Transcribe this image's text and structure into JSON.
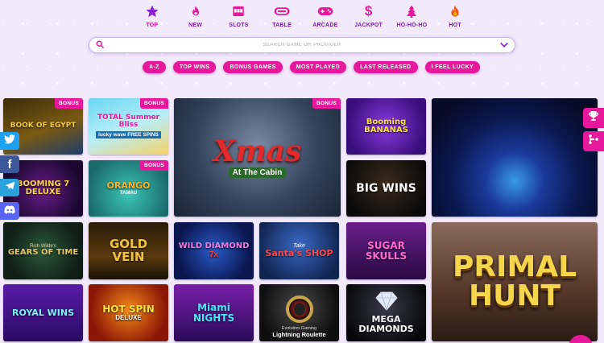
{
  "nav": {
    "items": [
      {
        "label": "TOP",
        "icon": "star-icon"
      },
      {
        "label": "NEW",
        "icon": "flame-icon"
      },
      {
        "label": "SLOTS",
        "icon": "slot-machine-icon"
      },
      {
        "label": "TABLE",
        "icon": "table-icon"
      },
      {
        "label": "ARCADE",
        "icon": "gamepad-icon"
      },
      {
        "label": "JACKPOT",
        "icon": "dollar-icon"
      },
      {
        "label": "HO-HO-HO",
        "icon": "christmas-tree-icon"
      },
      {
        "label": "HOT",
        "icon": "fire-icon"
      }
    ],
    "active": "TOP"
  },
  "search": {
    "placeholder": "SEARCH GAME OR PROVIDER"
  },
  "filters": [
    "A-Z",
    "TOP WINS",
    "BONUS GAMES",
    "MOST PLAYED",
    "LAST RELEASED",
    "I FEEL LUCKY"
  ],
  "badge_label": "BONUS",
  "games": {
    "book_of_egypt": {
      "title": "BOOK OF EGYPT"
    },
    "total_summer_bliss": {
      "title": "TOTAL Summer Bliss",
      "subtitle": "lucky wave FREE SPINS"
    },
    "xmas_cabin": {
      "title": "Xmas",
      "subtitle": "At The Cabin"
    },
    "booming_bananas": {
      "title": "Booming BANANAS"
    },
    "cosmic": {
      "title": ""
    },
    "booming_seven_deluxe": {
      "title": "BOOMING 7 DELUXE"
    },
    "orango": {
      "title": "ORANGO",
      "subtitle": "TAMAU"
    },
    "big_wins": {
      "title": "BIG WINS"
    },
    "gears_of_time": {
      "title": "GEARS OF TIME",
      "subtitle": "Rich Wilde's"
    },
    "gold_vein": {
      "title": "GOLD VEIN"
    },
    "wild_diamond": {
      "title": "WILD DIAMOND",
      "subtitle": "7x"
    },
    "santas_shop": {
      "title": "Santa's SHOP",
      "subtitle": "Take"
    },
    "sugar_skulls": {
      "title": "SUGAR SKULLS"
    },
    "primal_hunt": {
      "title": "PRIMAL HUNT"
    },
    "royal_wins": {
      "title": "ROYAL WINS"
    },
    "hot_spin_deluxe": {
      "title": "HOT SPIN",
      "subtitle": "DELUXE"
    },
    "miami_nights": {
      "title": "Miami NIGHTS"
    },
    "lightning_roulette": {
      "title": "Lightning Roulette",
      "subtitle": "Evolution Gaming"
    },
    "mega_diamonds": {
      "title": "MEGA DIAMONDS"
    }
  },
  "social": [
    {
      "name": "twitter-icon",
      "color": "#1da1f2"
    },
    {
      "name": "facebook-icon",
      "color": "#3b5998"
    },
    {
      "name": "telegram-icon",
      "color": "#2aa3dc"
    },
    {
      "name": "discord-icon",
      "color": "#5865f2"
    }
  ],
  "colors": {
    "accent": "#e8189c",
    "nav_label": "#7a1fb2",
    "background": "#f2e9fb"
  }
}
